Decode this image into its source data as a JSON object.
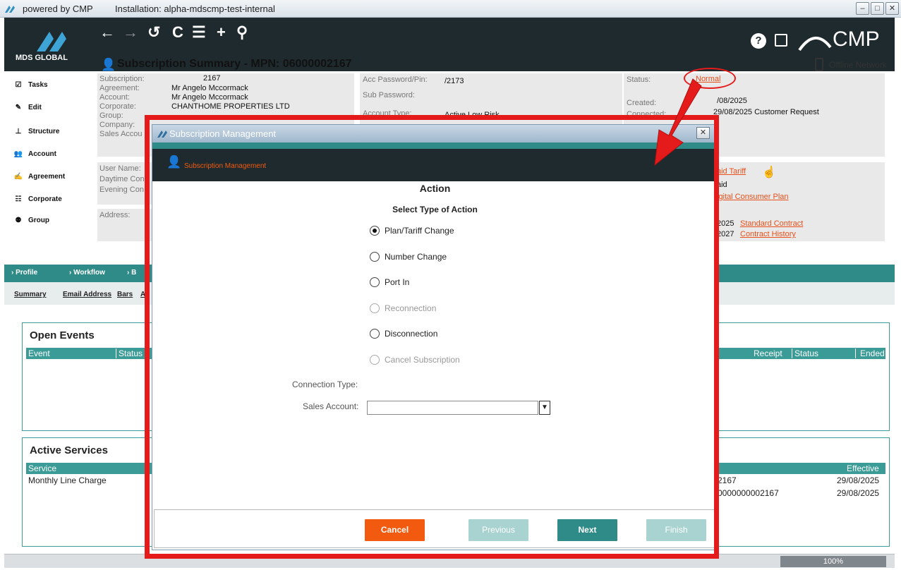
{
  "window": {
    "title_left": "powered by CMP",
    "installation": "Installation:  alpha-mdscmp-test-internal"
  },
  "brand": {
    "logo_text": "MDS GLOBAL",
    "cmp": "CMP"
  },
  "sidebar": {
    "items": [
      {
        "label": "Tasks",
        "icon": "tasks-icon"
      },
      {
        "label": "Edit",
        "icon": "edit-icon"
      },
      {
        "label": "Structure",
        "icon": "structure-icon"
      },
      {
        "label": "Account",
        "icon": "account-icon"
      },
      {
        "label": "Agreement",
        "icon": "agreement-icon"
      },
      {
        "label": "Corporate",
        "icon": "corporate-icon"
      },
      {
        "label": "Group",
        "icon": "group-icon"
      }
    ]
  },
  "summary": {
    "title": "Subscription Summary - MPN: 06000002167",
    "offline": "Offline Network",
    "left_labels": [
      "Subscription:",
      "Agreement:",
      "Account:",
      "Corporate:",
      "Group:",
      "Company:",
      "Sales Accou"
    ],
    "left_values": [
      "2167",
      "Mr Angelo Mccormack",
      "Mr Angelo Mccormack",
      "CHANTHOME PROPERTIES LTD"
    ],
    "user_labels": [
      "User Name:",
      "Daytime Con",
      "Evening Con"
    ],
    "address_label": "Address:",
    "acc_password_label": "Acc Password/Pin:",
    "acc_password_value": "/2173",
    "sub_password_label": "Sub Password:",
    "account_type_label": "Account Type:",
    "account_type_value": "Active Low Risk",
    "status_label": "Status:",
    "status_value": "Normal",
    "created_label": "Created:",
    "created_value": "/08/2025",
    "connected_label": "Connected:",
    "connected_value": "29/08/2025  Customer Request",
    "tariff_link": "aid Tariff",
    "paid_text": "aid",
    "plan_link": "igital Consumer Plan",
    "contract_date1": "2025",
    "contract_link1": "Standard Contract",
    "contract_date2": "2027",
    "contract_link2": "Contract History"
  },
  "tealbar": {
    "items": [
      "Profile",
      "Workflow",
      "B"
    ]
  },
  "subtabs": {
    "items": [
      "Summary",
      "Email Address",
      "Bars",
      "A"
    ]
  },
  "open_events": {
    "title": "Open Events",
    "columns_left": [
      "Event",
      "Status"
    ],
    "columns_right": [
      "Receipt",
      "Status",
      "Ended"
    ]
  },
  "active_services": {
    "title": "Active Services",
    "columns_left": [
      "Service"
    ],
    "column_right": "Effective",
    "rows_left": [
      "Monthly Line Charge"
    ],
    "rows_right": [
      {
        "mid": "2167",
        "date": "29/08/2025"
      },
      {
        "mid": "0000000002167",
        "date": "29/08/2025"
      }
    ]
  },
  "statusbar": {
    "zoom": "100%"
  },
  "dialog": {
    "title": "Subscription Management",
    "header": "Subscription Management",
    "section": "Action",
    "subsection": "Select Type of Action",
    "options": [
      {
        "label": "Plan/Tariff Change",
        "selected": true,
        "disabled": false
      },
      {
        "label": "Number Change",
        "selected": false,
        "disabled": false
      },
      {
        "label": "Port In",
        "selected": false,
        "disabled": false
      },
      {
        "label": "Reconnection",
        "selected": false,
        "disabled": true
      },
      {
        "label": "Disconnection",
        "selected": false,
        "disabled": false
      },
      {
        "label": "Cancel Subscription",
        "selected": false,
        "disabled": true
      }
    ],
    "connection_type_label": "Connection Type:",
    "sales_account_label": "Sales Account:",
    "sales_account_value": "",
    "buttons": {
      "cancel": "Cancel",
      "previous": "Previous",
      "next": "Next",
      "finish": "Finish"
    }
  },
  "colors": {
    "teal": "#2e8b87",
    "dark": "#1f2a2e",
    "orange": "#f15a0f",
    "highlight": "#e51b1b"
  }
}
